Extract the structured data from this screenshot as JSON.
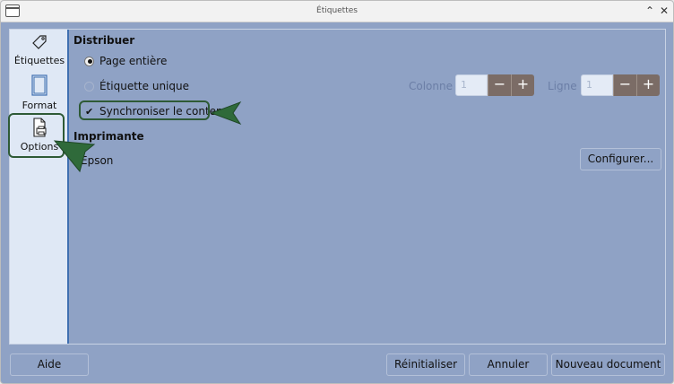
{
  "window": {
    "title": "Étiquettes"
  },
  "sidebar": {
    "items": [
      {
        "label": "Étiquettes",
        "icon": "tag-icon"
      },
      {
        "label": "Format",
        "icon": "page-format-icon"
      },
      {
        "label": "Options",
        "icon": "printer-page-icon"
      }
    ]
  },
  "distribute": {
    "title": "Distribuer",
    "full_page": "Page entière",
    "single_label": "Étiquette unique",
    "sync_contents": "Synchroniser le contenu",
    "column_label": "Colonne",
    "column_value": "1",
    "row_label": "Ligne",
    "row_value": "1",
    "minus": "−",
    "plus": "+"
  },
  "printer": {
    "title": "Imprimante",
    "name": "Epson",
    "setup_label": "Configurer..."
  },
  "footer": {
    "help": "Aide",
    "reset": "Réinitialiser",
    "cancel": "Annuler",
    "new_document": "Nouveau document"
  },
  "colors": {
    "accent": "#3f6fb0",
    "highlight": "#2e5a36",
    "background": "#8fa2c5"
  }
}
